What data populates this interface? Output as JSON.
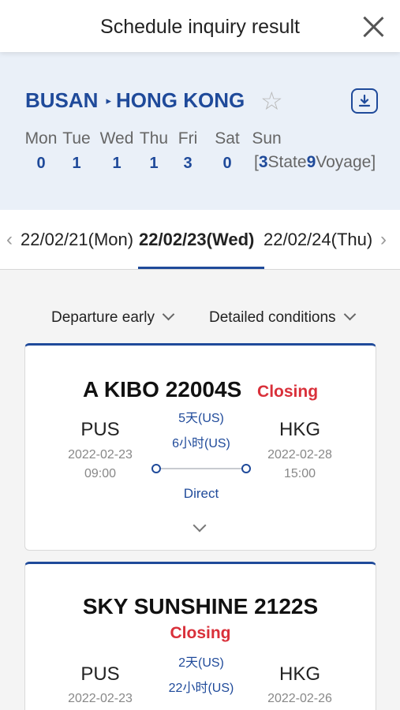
{
  "header": {
    "title": "Schedule inquiry result"
  },
  "route": {
    "origin": "BUSAN",
    "arrow": "▸",
    "destination": "HONG KONG"
  },
  "week": [
    {
      "day": "Mon",
      "count": "0"
    },
    {
      "day": "Tue",
      "count": "1"
    },
    {
      "day": "Wed",
      "count": "1"
    },
    {
      "day": "Thu",
      "count": "1"
    },
    {
      "day": "Fri",
      "count": "3"
    },
    {
      "day": "Sat",
      "count": "0"
    },
    {
      "day": "Sun",
      "count": "3"
    }
  ],
  "status_voyage": {
    "open": "[",
    "state_label": "State",
    "voyage_count": "9",
    "voyage_label": "Voyage]"
  },
  "dates": {
    "prev": "22/02/21(Mon)",
    "current": "22/02/23(Wed)",
    "next": "22/02/24(Thu)"
  },
  "filters": {
    "sort": "Departure early",
    "conditions": "Detailed conditions"
  },
  "results": [
    {
      "vessel": "A KIBO 22004S",
      "status": "Closing",
      "from": "PUS",
      "from_date": "2022-02-23",
      "from_time": "09:00",
      "to": "HKG",
      "to_date": "2022-02-28",
      "to_time": "15:00",
      "days": "5天(US)",
      "hours": "6小时(US)",
      "type": "Direct"
    },
    {
      "vessel": "SKY SUNSHINE 2122S",
      "status": "Closing",
      "from": "PUS",
      "from_date": "2022-02-23",
      "to": "HKG",
      "to_date": "2022-02-26",
      "days": "2天(US)",
      "hours": "22小时(US)"
    }
  ],
  "colors": {
    "accent": "#1f4a9a",
    "closing": "#d9303a",
    "panel": "#eaf0f8"
  }
}
